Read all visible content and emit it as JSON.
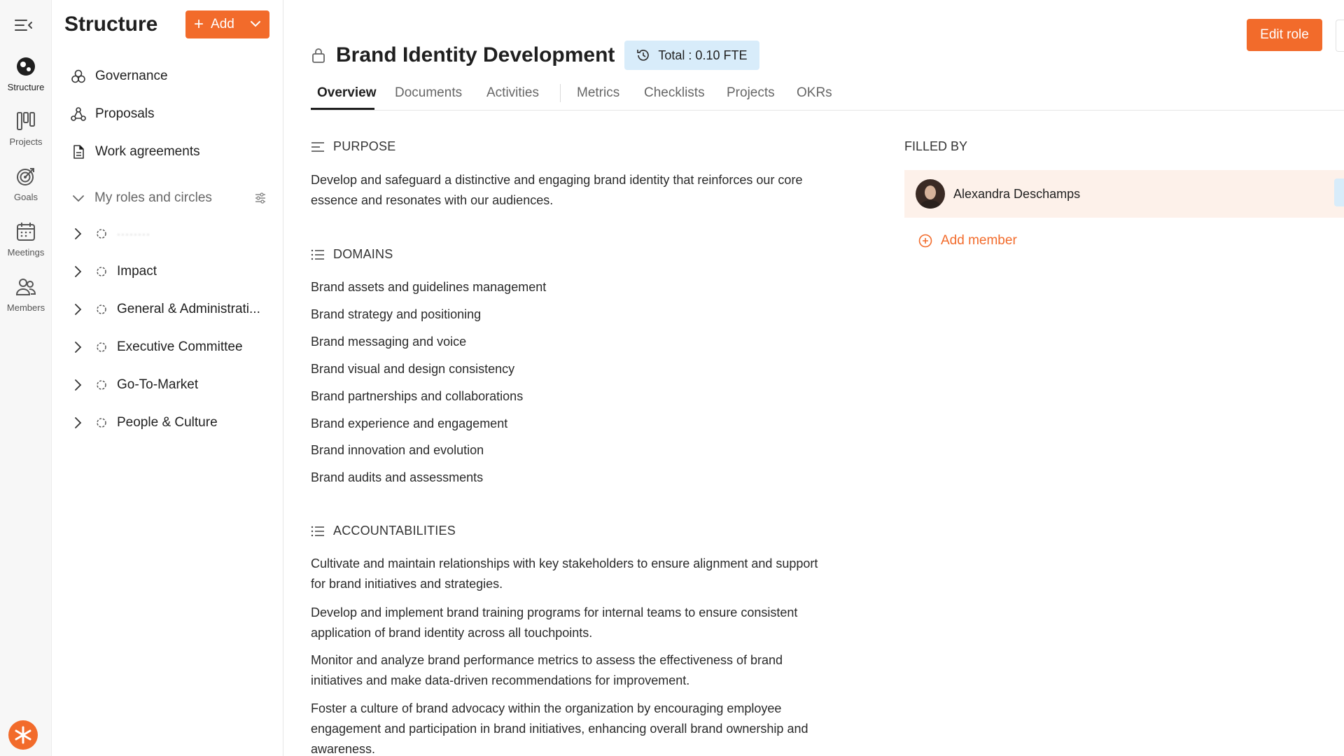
{
  "rail": {
    "items": [
      {
        "label": "Structure",
        "icon": "structure-icon"
      },
      {
        "label": "Projects",
        "icon": "projects-icon"
      },
      {
        "label": "Goals",
        "icon": "goals-icon"
      },
      {
        "label": "Meetings",
        "icon": "calendar-icon"
      },
      {
        "label": "Members",
        "icon": "members-icon"
      }
    ]
  },
  "sidebar": {
    "title": "Structure",
    "add_label": "Add",
    "links": [
      {
        "label": "Governance",
        "icon": "governance-icon"
      },
      {
        "label": "Proposals",
        "icon": "proposals-icon"
      },
      {
        "label": "Work agreements",
        "icon": "document-icon"
      }
    ],
    "section_label": "My roles and circles",
    "circles": [
      {
        "label": "········"
      },
      {
        "label": "Impact"
      },
      {
        "label": "General & Administrati..."
      },
      {
        "label": "Executive Committee"
      },
      {
        "label": "Go-To-Market"
      },
      {
        "label": "People & Culture"
      }
    ]
  },
  "role": {
    "title": "Brand Identity Development",
    "fte": "Total : 0.10 FTE",
    "edit_label": "Edit role"
  },
  "tabs": [
    "Overview",
    "Documents",
    "Activities",
    "Metrics",
    "Checklists",
    "Projects",
    "OKRs"
  ],
  "purpose": {
    "heading": "PURPOSE",
    "line1": "Develop and safeguard a distinctive and engaging brand identity that reinforces our core",
    "line2": "essence and resonates with our audiences."
  },
  "domains": {
    "heading": "DOMAINS",
    "items": [
      "Brand assets and guidelines management",
      "Brand strategy and positioning",
      "Brand messaging and voice",
      "Brand visual and design consistency",
      "Brand partnerships and collaborations",
      "Brand experience and engagement",
      "Brand innovation and evolution",
      "Brand audits and assessments"
    ]
  },
  "accountabilities": {
    "heading": "ACCOUNTABILITIES",
    "items": [
      {
        "l1": "Cultivate and maintain relationships with key stakeholders to ensure alignment and support",
        "l2": "for brand initiatives and strategies."
      },
      {
        "l1": "Develop and implement brand training programs for internal teams to ensure consistent",
        "l2": "application of brand identity across all touchpoints."
      },
      {
        "l1": "Monitor and analyze brand performance metrics to assess the effectiveness of brand",
        "l2": "initiatives and make data-driven recommendations for improvement."
      },
      {
        "l1": "Foster a culture of brand advocacy within the organization by encouraging employee",
        "l2": "engagement and participation in brand initiatives, enhancing overall brand ownership and",
        "l3": "awareness."
      }
    ]
  },
  "filled_by": {
    "heading": "FILLED BY",
    "member_name": "Alexandra Deschamps",
    "add_member_label": "Add member"
  },
  "colors": {
    "accent": "#f26b2b",
    "badge": "#d8ecfa",
    "member_bg": "#fdf1ea"
  }
}
